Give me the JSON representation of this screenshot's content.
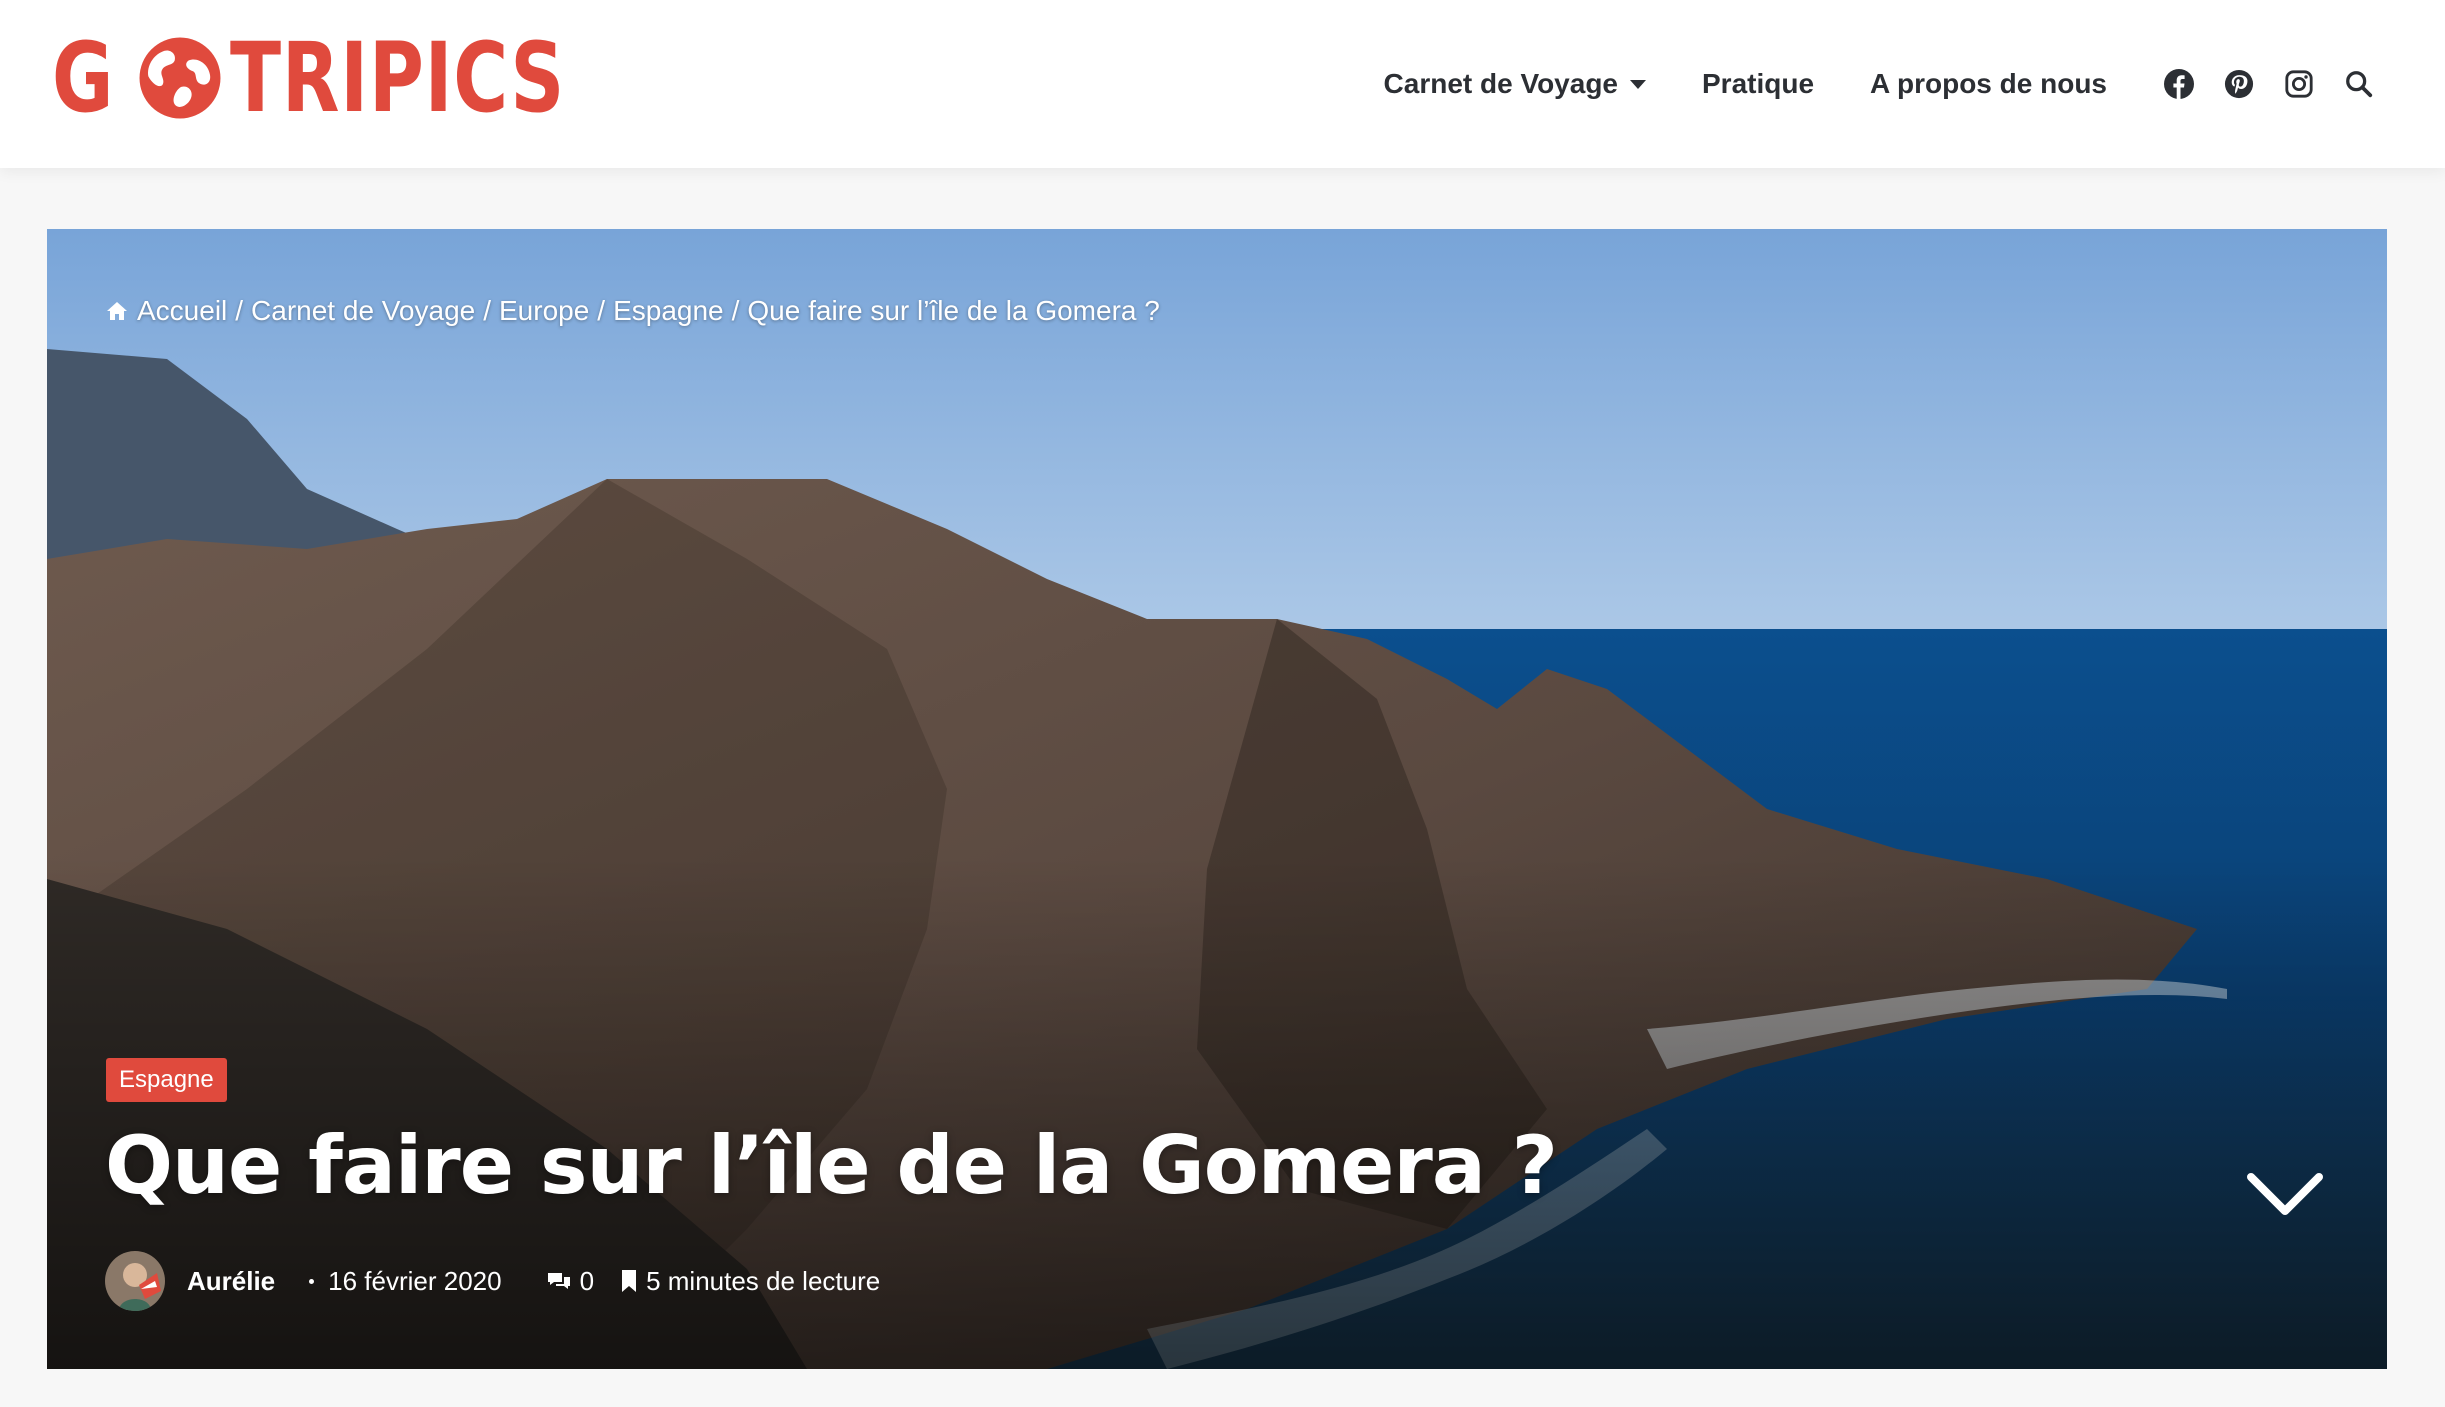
{
  "header": {
    "logo_text_left": "G",
    "logo_text_right": "TRIPICS",
    "brand_color": "#e04a3d",
    "nav": [
      {
        "label": "Carnet de Voyage",
        "has_dropdown": true
      },
      {
        "label": "Pratique",
        "has_dropdown": false
      },
      {
        "label": "A propos de nous",
        "has_dropdown": false
      }
    ],
    "social_icons": [
      "facebook-icon",
      "pinterest-icon",
      "instagram-icon",
      "search-icon"
    ]
  },
  "hero": {
    "breadcrumb": [
      "Accueil",
      "Carnet de Voyage",
      "Europe",
      "Espagne",
      "Que faire sur l’île de la Gomera ?"
    ],
    "category": "Espagne",
    "title": "Que faire sur l’île de la Gomera ?",
    "meta": {
      "author": "Aurélie",
      "date": "16 février 2020",
      "comments": "0",
      "reading_time": "5 minutes de lecture"
    }
  },
  "colors": {
    "header_bg": "#ffffff",
    "page_bg": "#f7f7f7",
    "text_dark": "#2c2f34",
    "accent": "#e04a3d"
  }
}
